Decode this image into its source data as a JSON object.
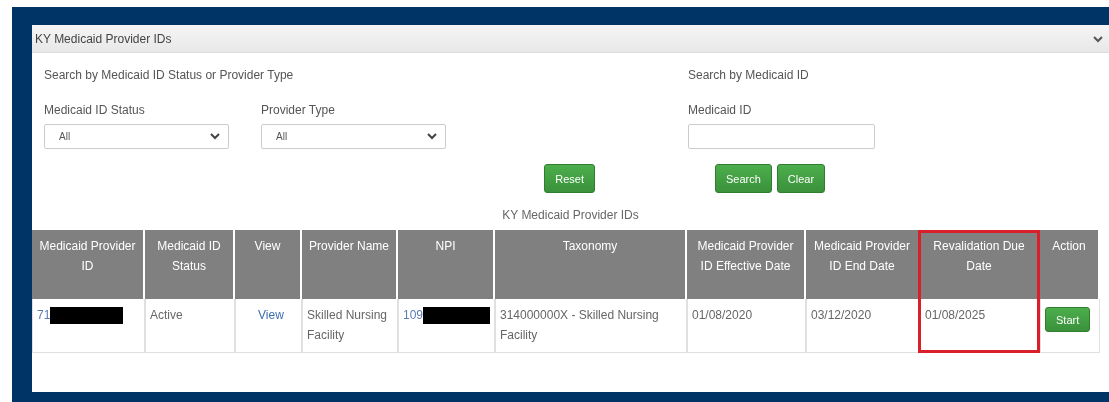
{
  "panel": {
    "title": "KY Medicaid Provider IDs",
    "expanded": true
  },
  "filters": {
    "heading": "Search by Medicaid ID Status or Provider Type",
    "fields": [
      {
        "label": "Medicaid ID Status",
        "value": "All"
      },
      {
        "label": "Provider Type",
        "value": "All"
      }
    ],
    "reset_button": "Reset"
  },
  "id_search": {
    "heading": "Search by Medicaid ID",
    "field_label": "Medicaid ID",
    "buttons": [
      "Search",
      "Clear"
    ]
  },
  "table": {
    "caption": "KY Medicaid Provider IDs",
    "columns": [
      {
        "label": "Medicaid Provider ID",
        "highlighted": false
      },
      {
        "label": "Medicaid ID Status",
        "highlighted": false
      },
      {
        "label": "View",
        "highlighted": false
      },
      {
        "label": "Provider Name",
        "highlighted": false
      },
      {
        "label": "NPI",
        "highlighted": false
      },
      {
        "label": "Taxonomy",
        "highlighted": false
      },
      {
        "label": "Medicaid Provider ID Effective Date",
        "highlighted": false
      },
      {
        "label": "Medicaid Provider ID End Date",
        "highlighted": false
      },
      {
        "label": "Revalidation Due Date",
        "highlighted": true
      },
      {
        "label": "Action",
        "highlighted": false
      }
    ],
    "rows": [
      {
        "cells": [
          {
            "kind": "redacted",
            "text": "71"
          },
          {
            "kind": "text",
            "text": "Active"
          },
          {
            "kind": "link",
            "text": "View"
          },
          {
            "kind": "text",
            "text": "Skilled Nursing Facility"
          },
          {
            "kind": "redacted",
            "text": "109"
          },
          {
            "kind": "text",
            "text": "314000000X - Skilled Nursing Facility"
          },
          {
            "kind": "text",
            "text": "01/08/2020"
          },
          {
            "kind": "text",
            "text": "03/12/2020"
          },
          {
            "kind": "text",
            "text": "01/08/2025"
          },
          {
            "kind": "button",
            "text": "Start"
          }
        ]
      }
    ]
  }
}
